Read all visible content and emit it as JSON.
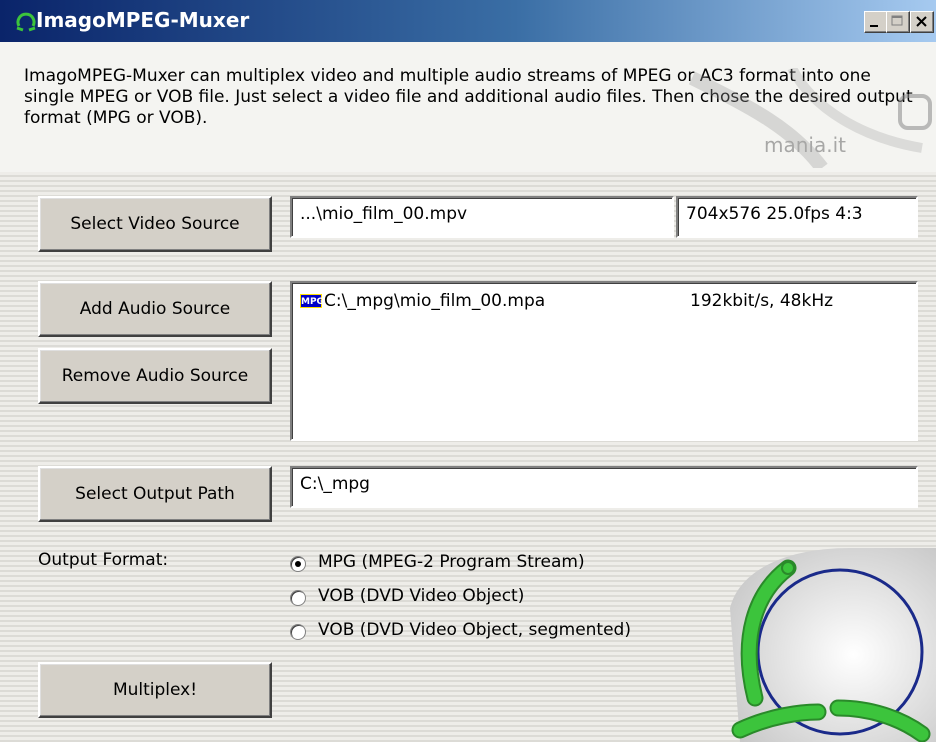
{
  "window": {
    "title": "ImagoMPEG-Muxer",
    "controls": [
      "minimize",
      "maximize",
      "close"
    ]
  },
  "description": "ImagoMPEG-Muxer can multiplex video and multiple audio streams of MPEG or AC3 format into one single MPEG or VOB file. Just select a video file and additional audio files. Then chose the desired output format (MPG or VOB).",
  "watermark": {
    "text": "mania.it"
  },
  "video": {
    "button_label": "Select Video Source",
    "path": "...\\mio_film_00.mpv",
    "info": "704x576 25.0fps 4:3"
  },
  "audio": {
    "add_label": "Add Audio Source",
    "remove_label": "Remove Audio Source",
    "items": [
      {
        "badge": "MPG",
        "file": "C:\\_mpg\\mio_film_00.mpa",
        "info": "192kbit/s, 48kHz"
      }
    ]
  },
  "output": {
    "button_label": "Select Output Path",
    "path": "C:\\_mpg"
  },
  "format": {
    "label": "Output Format:",
    "options": [
      {
        "label": "MPG (MPEG-2 Program Stream)",
        "selected": true
      },
      {
        "label": "VOB (DVD Video Object)",
        "selected": false
      },
      {
        "label": "VOB (DVD Video Object, segmented)",
        "selected": false
      }
    ]
  },
  "multiplex_label": "Multiplex!",
  "colors": {
    "title_start": "#0a246a",
    "title_end": "#a6caf0",
    "logo_green": "#3cc43c",
    "logo_blue": "#1a2a8a"
  }
}
